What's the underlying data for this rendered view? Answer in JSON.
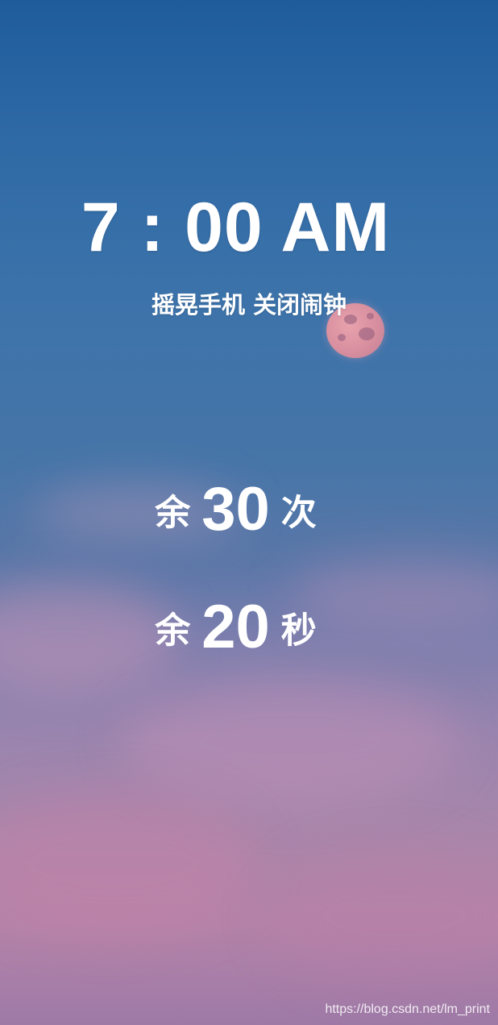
{
  "alarm": {
    "time": "7 : 00 AM",
    "hint": "摇晃手机 关闭闹钟"
  },
  "shakes": {
    "prefix": "余",
    "value": "30",
    "suffix": "次"
  },
  "seconds": {
    "prefix": "余",
    "value": "20",
    "suffix": "秒"
  },
  "watermark": "https://blog.csdn.net/lm_print"
}
